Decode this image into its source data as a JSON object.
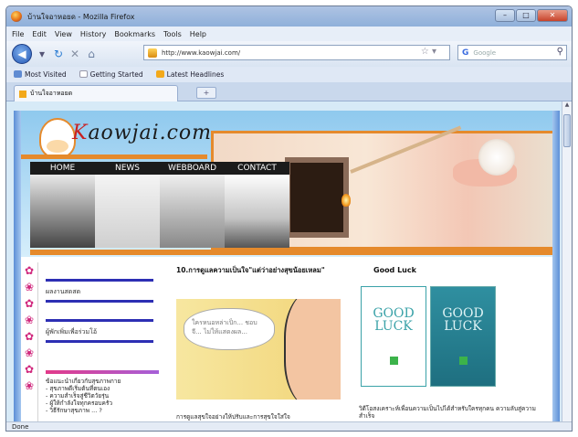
{
  "window": {
    "title": "บ้านใจอาหอยด - Mozilla Firefox"
  },
  "menu": [
    "File",
    "Edit",
    "View",
    "History",
    "Bookmarks",
    "Tools",
    "Help"
  ],
  "nav": {
    "url": "http://www.kaowjai.com/",
    "search_placeholder": "Google",
    "search_engine": "G"
  },
  "bookmarks": [
    "Most Visited",
    "Getting Started",
    "Latest Headlines"
  ],
  "tab": {
    "label": "บ้านใจอาหอยด",
    "new_tab": "+"
  },
  "status": "Done",
  "site": {
    "logo_k": "K",
    "logo_rest": "aowjai.com",
    "nav": [
      "HOME",
      "NEWS",
      "WEBBOARD",
      "CONTACT"
    ],
    "sidebar": {
      "block1": "ผลงานสดสด",
      "block2": "ผู้พักเพิ่มเพื่อร่วมโอ้",
      "list_title": "ข้อแนะนำเกี่ยวกับสุขภาพกาย",
      "list": [
        "- สุขภาพดีเริ่มต้นที่ตนเอง",
        "- ความสำเร็จสู่ชีวิตวัยรุ่น",
        "- ผู้ให้กำลังใจทุกครอบครัว",
        "- วิธีรักษาสุขภาพ ... ?"
      ]
    },
    "article1": {
      "heading": "10.การดูแลความเป็นใจ\"แต่ว่าอย่างสุขน้อยเหลม\"",
      "bubble": "ใครหนอหล่าเป็ก... ชอบจี... ไม่ให้แสดงผล...",
      "caption": "การดูแลสุขใจอย่างให้ปรับและการสุขใจใส่ใจ"
    },
    "article2": {
      "heading": "Good Luck",
      "book1_title": "GOOD LUCK",
      "book2_title": "GOOD LUCK",
      "caption": "วิดีโอสงเคราะห์เพื่อนความเป็นไปได้สำหรับใครทุกคน ความลับสู่ความสำเร็จ"
    }
  }
}
